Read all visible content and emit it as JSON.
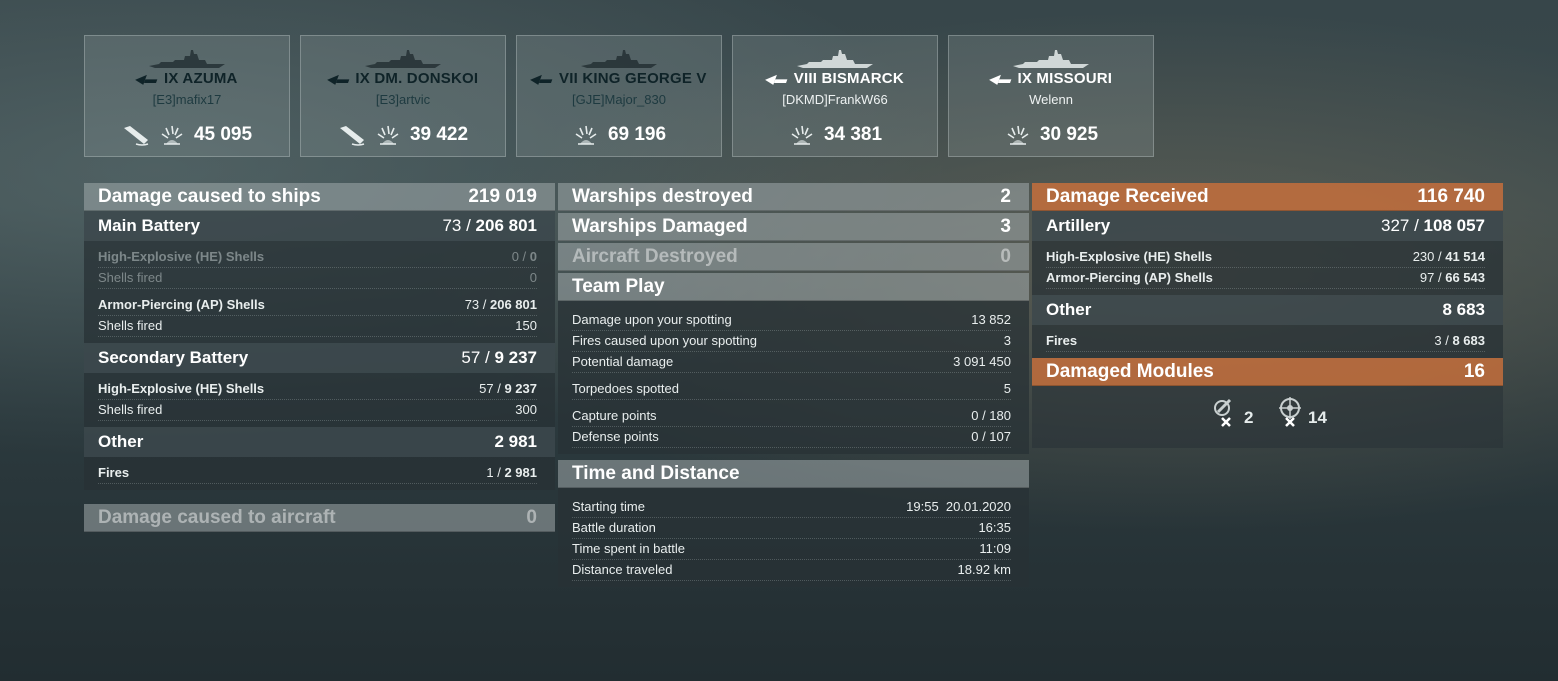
{
  "ships": [
    {
      "name": "IX AZUMA",
      "player": "[E3]mafix17",
      "damage": "45 095",
      "sunk": true,
      "premium": false
    },
    {
      "name": "IX DM. DONSKOI",
      "player": "[E3]artvic",
      "damage": "39 422",
      "sunk": true,
      "premium": false
    },
    {
      "name": "VII KING GEORGE V",
      "player": "[GJE]Major_830",
      "damage": "69 196",
      "sunk": false,
      "premium": false
    },
    {
      "name": "VIII BISMARCK",
      "player": "[DKMD]FrankW66",
      "damage": "34 381",
      "sunk": false,
      "premium": true
    },
    {
      "name": "IX MISSOURI",
      "player": "Welenn",
      "damage": "30 925",
      "sunk": false,
      "premium": true
    }
  ],
  "damage_caused": {
    "title": "Damage caused to ships",
    "total": "219 019",
    "main_battery": {
      "label": "Main Battery",
      "hits": "73",
      "damage": "206 801"
    },
    "he": {
      "label": "High-Explosive (HE) Shells",
      "hits": "0",
      "damage": "0",
      "fired_label": "Shells fired",
      "fired": "0"
    },
    "ap": {
      "label": "Armor-Piercing (AP) Shells",
      "hits": "73",
      "damage": "206 801",
      "fired_label": "Shells fired",
      "fired": "150"
    },
    "secondary": {
      "label": "Secondary Battery",
      "hits": "57",
      "damage": "9 237"
    },
    "sec_he": {
      "label": "High-Explosive (HE) Shells",
      "hits": "57",
      "damage": "9 237",
      "fired_label": "Shells fired",
      "fired": "300"
    },
    "other": {
      "label": "Other",
      "total": "2 981"
    },
    "fires": {
      "label": "Fires",
      "hits": "1",
      "damage": "2 981"
    },
    "aircraft": {
      "label": "Damage caused to aircraft",
      "total": "0"
    }
  },
  "middle": {
    "destroyed": {
      "label": "Warships destroyed",
      "value": "2"
    },
    "damaged": {
      "label": "Warships Damaged",
      "value": "3"
    },
    "aircraft": {
      "label": "Aircraft Destroyed",
      "value": "0"
    },
    "team_play": {
      "title": "Team Play",
      "spot_damage": {
        "label": "Damage upon your spotting",
        "value": "13 852"
      },
      "spot_fires": {
        "label": "Fires caused upon your spotting",
        "value": "3"
      },
      "potential": {
        "label": "Potential damage",
        "value": "3 091 450"
      },
      "torpedoes": {
        "label": "Torpedoes spotted",
        "value": "5"
      },
      "capture": {
        "label": "Capture points",
        "value": "0 / 180"
      },
      "defense": {
        "label": "Defense points",
        "value": "0 / 107"
      }
    },
    "time": {
      "title": "Time and Distance",
      "start": {
        "label": "Starting time",
        "value": "19:55  20.01.2020"
      },
      "duration": {
        "label": "Battle duration",
        "value": "16:35"
      },
      "spent": {
        "label": "Time spent in battle",
        "value": "11:09"
      },
      "distance": {
        "label": "Distance traveled",
        "value": "18.92 km"
      }
    }
  },
  "received": {
    "title": "Damage Received",
    "total": "116 740",
    "artillery": {
      "label": "Artillery",
      "hits": "327",
      "damage": "108 057"
    },
    "he": {
      "label": "High-Explosive (HE) Shells",
      "hits": "230",
      "damage": "41 514"
    },
    "ap": {
      "label": "Armor-Piercing (AP) Shells",
      "hits": "97",
      "damage": "66 543"
    },
    "other": {
      "label": "Other",
      "total": "8 683"
    },
    "fires": {
      "label": "Fires",
      "hits": "3",
      "damage": "8 683"
    },
    "modules": {
      "label": "Damaged Modules",
      "total": "16",
      "guns": "2",
      "steering": "14"
    }
  },
  "sep": " / "
}
